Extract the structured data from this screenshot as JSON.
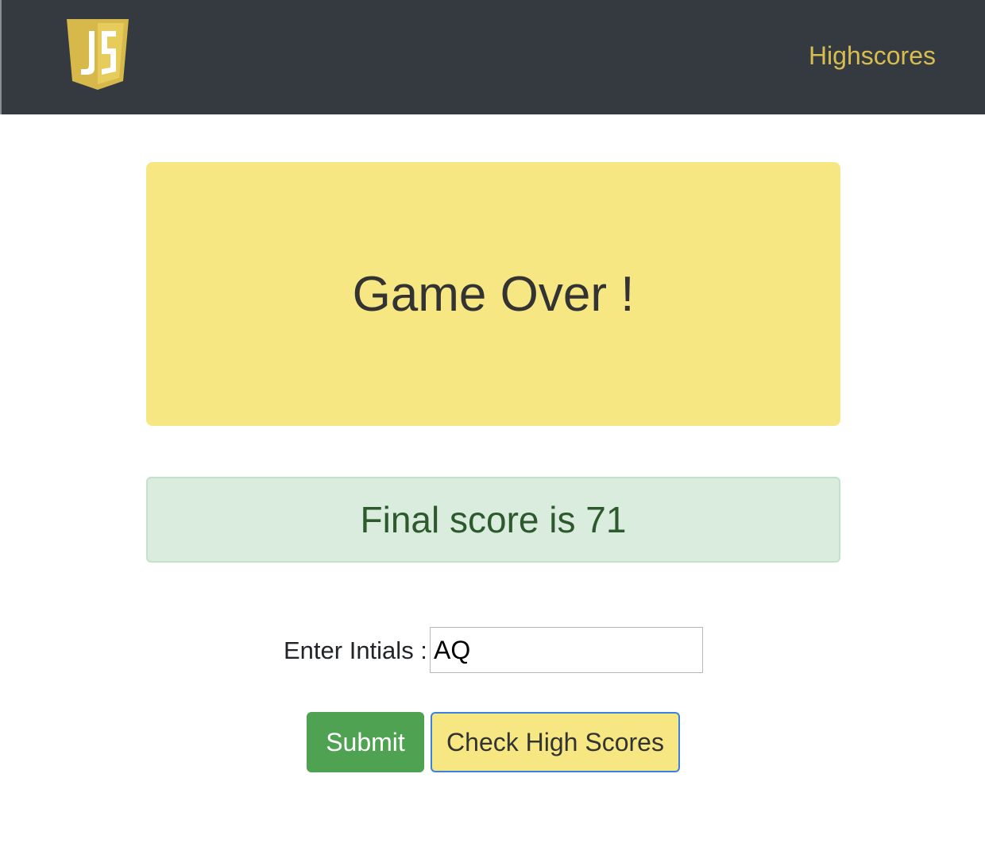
{
  "navbar": {
    "logo_icon": "javascript-shield-logo",
    "logo_text": "JS",
    "highscores_link": "Highscores",
    "background_color": "#343a40",
    "link_color": "#d7bd4f"
  },
  "game_over": {
    "title": "Game Over !",
    "background_color": "#f6e782"
  },
  "score": {
    "text": "Final score is 71",
    "background_color": "#d9ecdd",
    "text_color": "#2c5a2c"
  },
  "initials": {
    "label": "Enter Intials :",
    "value": "AQ"
  },
  "actions": {
    "submit_label": "Submit",
    "check_high_scores_label": "Check High Scores",
    "submit_color": "#4fa251",
    "check_high_scores_color": "#f6e782"
  }
}
